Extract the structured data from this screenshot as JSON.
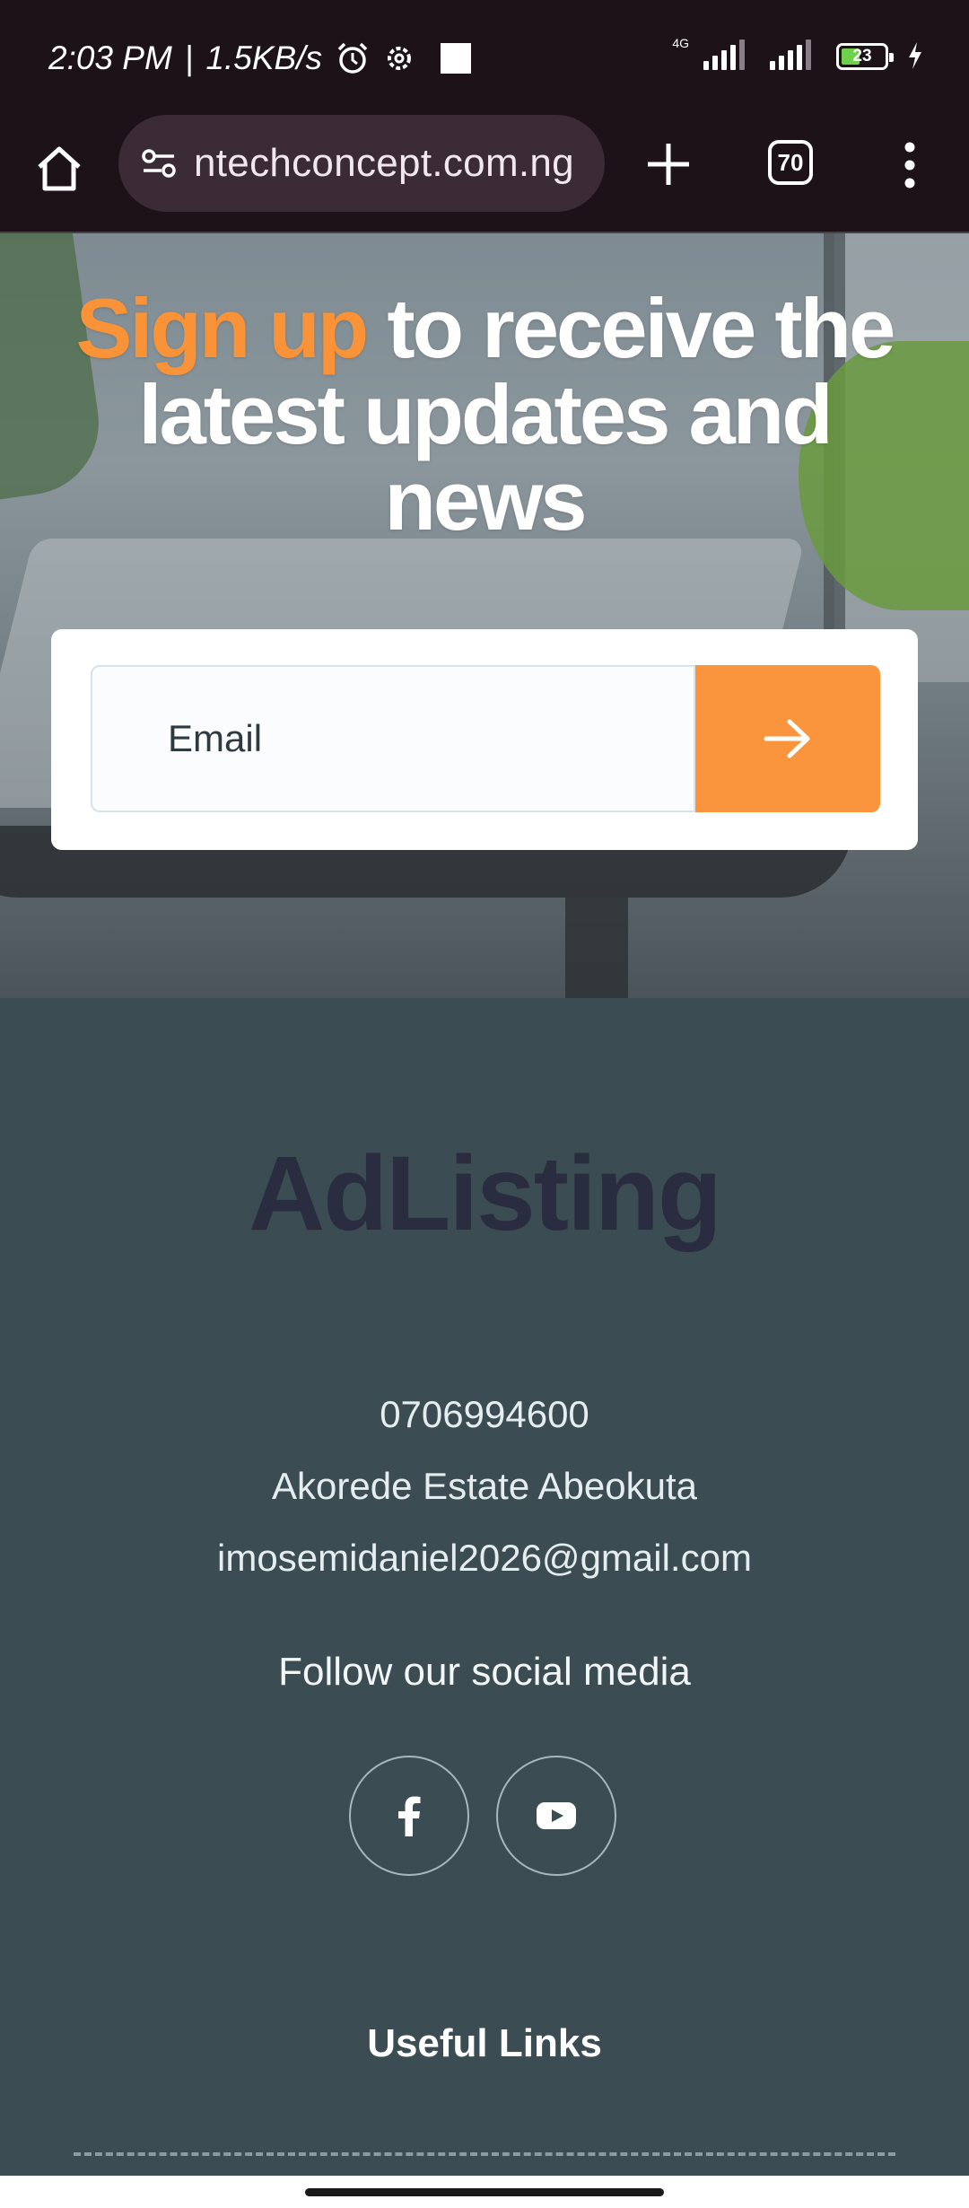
{
  "status_bar": {
    "time": "2:03 PM",
    "speed": "1.5KB/s",
    "network": "4G",
    "battery_level": "23"
  },
  "browser": {
    "url": "ntechconcept.com.ng",
    "tab_count": "70"
  },
  "signup": {
    "heading_accent": "Sign up",
    "heading_rest": " to receive the latest updates and news",
    "email_placeholder": "Email",
    "accent_color": "#fa9237"
  },
  "footer": {
    "logo_text": "AdListing",
    "phone": "0706994600",
    "address": "Akorede Estate Abeokuta",
    "email": "imosemidaniel2026@gmail.com",
    "follow_label": "Follow our social media",
    "social": [
      {
        "icon": "facebook-icon"
      },
      {
        "icon": "youtube-icon"
      }
    ],
    "useful_links_title": "Useful Links",
    "background_color": "#3b4d53"
  }
}
